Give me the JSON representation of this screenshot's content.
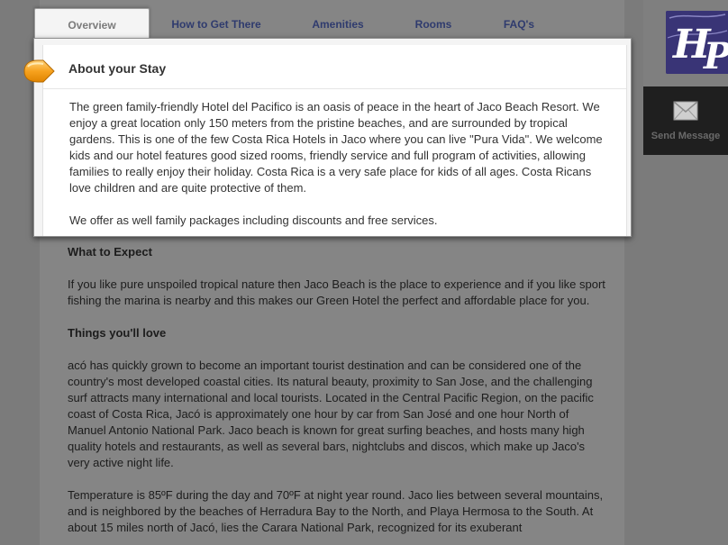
{
  "tabs": [
    {
      "label": "Overview"
    },
    {
      "label": "How to Get There"
    },
    {
      "label": "Amenities"
    },
    {
      "label": "Rooms"
    },
    {
      "label": "FAQ's"
    }
  ],
  "sidebar": {
    "logo_text": "HP",
    "send_label": "Send Message",
    "send_icon": "envelope-icon"
  },
  "popup": {
    "title": "About your Stay",
    "paragraphs": [
      "The green family-friendly Hotel del Pacifico is an oasis of peace in the heart of Jaco Beach Resort. We enjoy a great location only 150 meters from the pristine beaches, and are surrounded by tropical gardens. This is one of the few Costa Rica Hotels in Jaco where you can live \"Pura Vida\". We welcome kids and our hotel features good sized rooms, friendly service and full program of activities, allowing families to really enjoy their holiday. Costa Rica is a very safe place for kids of all ages. Costa Ricans love children and are quite protective of them.",
      "We offer as well family packages including discounts and free services."
    ]
  },
  "content": {
    "expect_heading": "What to Expect",
    "expect_text": "If you like pure unspoiled tropical nature then Jaco Beach is the place to experience and if you like sport fishing the marina is nearby and this makes our Green Hotel the perfect and affordable place for you.",
    "love_heading": "Things you'll love",
    "love_text": "acó has quickly grown to become an important tourist destination and can be considered one of the country's most developed coastal cities. Its natural beauty, proximity to San Jose, and the challenging surf attracts many international and local tourists. Located in the Central Pacific Region, on the pacific coast of Costa Rica, Jacó is approximately one hour by car from San José and one hour North of Manuel Antonio National Park. Jaco beach is known for great surfing beaches, and hosts many high quality hotels and restaurants, as well as several bars, nightclubs and discos, which make up Jaco's very active night life.",
    "temp_text": "Temperature is 85ºF during the day and 70ºF at night year round. Jaco lies between several mountains, and is neighbored by the beaches of Herradura Bay to the North, and Playa Hermosa to the South. At about 15 miles north of Jacó, lies the Carara National Park, recognized for its exuberant"
  },
  "colors": {
    "overlay_bg": "#7b7b7b",
    "tab_text": "#2f3b6e",
    "logo_bg": "#393476",
    "marker": "#f5a623"
  }
}
